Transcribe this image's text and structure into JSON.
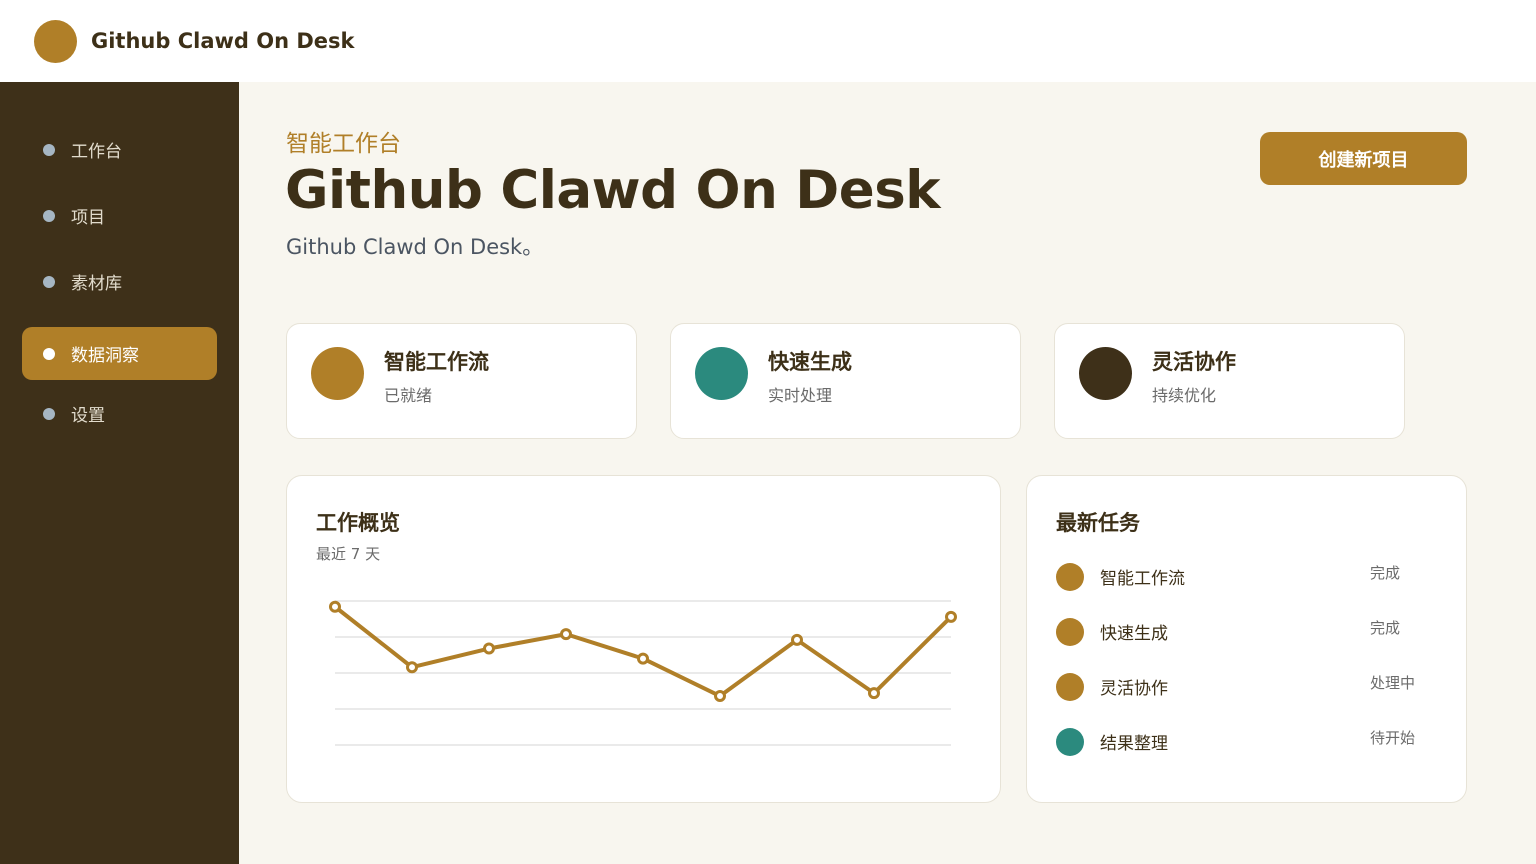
{
  "app": {
    "title": "Github Clawd On Desk"
  },
  "sidebar": {
    "items": [
      {
        "label": "工作台",
        "active": false
      },
      {
        "label": "项目",
        "active": false
      },
      {
        "label": "素材库",
        "active": false
      },
      {
        "label": "数据洞察",
        "active": true
      },
      {
        "label": "设置",
        "active": false
      }
    ]
  },
  "header": {
    "eyebrow": "智能工作台",
    "title": "Github Clawd On Desk",
    "subtitle": "Github Clawd On Desk。",
    "create_button": "创建新项目"
  },
  "stats": [
    {
      "title": "智能工作流",
      "subtitle": "已就绪",
      "color": "#b07f28"
    },
    {
      "title": "快速生成",
      "subtitle": "实时处理",
      "color": "#2b8a7e"
    },
    {
      "title": "灵活协作",
      "subtitle": "持续优化",
      "color": "#3e3019"
    }
  ],
  "overview": {
    "title": "工作概览",
    "subtitle": "最近 7 天"
  },
  "chart_data": {
    "type": "line",
    "title": "工作概览",
    "subtitle": "最近 7 天",
    "x": [
      1,
      2,
      3,
      4,
      5,
      6,
      7,
      8,
      9
    ],
    "ylim": [
      0,
      100
    ],
    "grid": true,
    "series": [
      {
        "values": [
          96,
          54,
          67,
          77,
          60,
          34,
          73,
          36,
          89
        ],
        "color": "#b07f28"
      }
    ]
  },
  "tasks": {
    "title": "最新任务",
    "items": [
      {
        "name": "智能工作流",
        "status": "完成",
        "color": "#b07f28"
      },
      {
        "name": "快速生成",
        "status": "完成",
        "color": "#b07f28"
      },
      {
        "name": "灵活协作",
        "status": "处理中",
        "color": "#b07f28"
      },
      {
        "name": "结果整理",
        "status": "待开始",
        "color": "#2b8a7e"
      }
    ]
  }
}
